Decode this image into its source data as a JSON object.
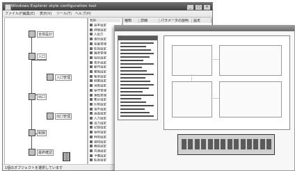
{
  "app": {
    "title": "Windows Explorer style configuration tool"
  },
  "menu": [
    "ファイル(F)",
    "編集(E)",
    "表示(V)",
    "ツール(T)",
    "ヘルプ(H)"
  ],
  "left_tree": {
    "nodes": [
      {
        "label": "全体設計"
      },
      {
        "label": "入口"
      },
      {
        "label": "入口管理"
      },
      {
        "label": "出口"
      },
      {
        "label": "出口管理"
      },
      {
        "label": "制御"
      },
      {
        "label": "最終確認"
      }
    ]
  },
  "list": {
    "header": "名前",
    "items": [
      "基本設定",
      "詳細設定",
      "入出力",
      "通信設定",
      "装置管理",
      "監視設定",
      "履歴管理",
      "接続設定",
      "表示設定",
      "動作設定",
      "警報設定",
      "帳票設定",
      "制御設定",
      "演算設定",
      "保守管理",
      "運転管理",
      "集計設定",
      "印刷設定",
      "音声設定",
      "画面設定",
      "入力設定",
      "出力設定",
      "記録設定",
      "保存設定",
      "時刻設定",
      "通知設定",
      "補助設定",
      "共通設定",
      "予備設定",
      "拡張設定"
    ]
  },
  "right_header": [
    "種類",
    "詳細",
    "パラメータの説明",
    "設定"
  ],
  "status": {
    "text": "1個のオブジェクトを選択しています"
  },
  "colors": {
    "title_bar": "#3f3f3f",
    "panel_bg": "#ffffff"
  }
}
